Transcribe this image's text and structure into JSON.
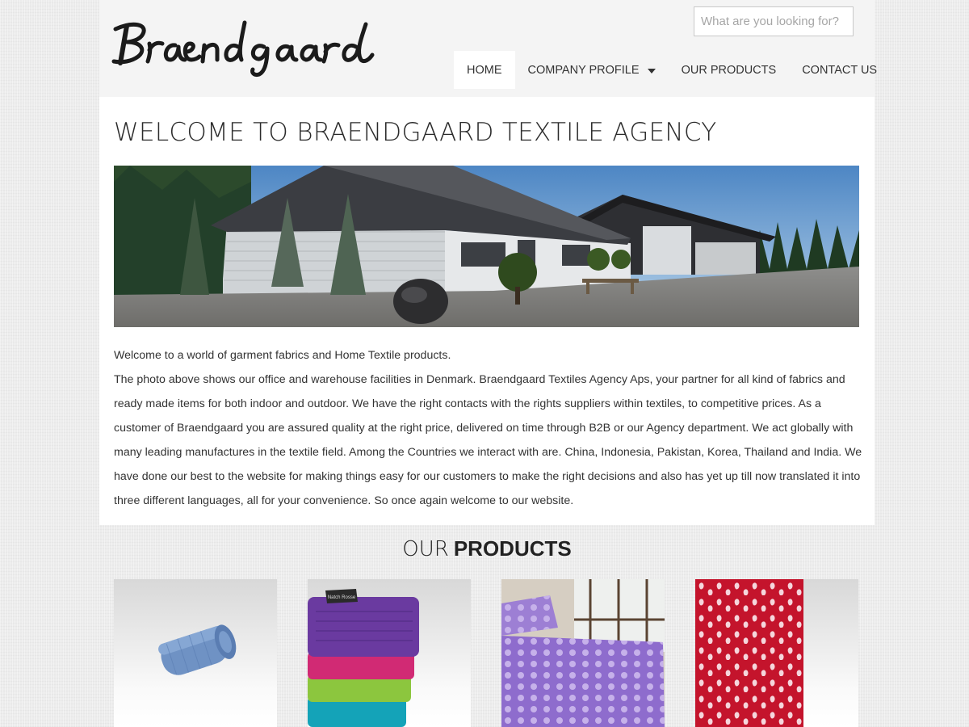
{
  "header": {
    "logo_text": "Braendgaard",
    "search_placeholder": "What are you looking for?",
    "nav": [
      {
        "label": "HOME",
        "active": true
      },
      {
        "label": "COMPANY PROFILE",
        "has_dropdown": true
      },
      {
        "label": "OUR PRODUCTS"
      },
      {
        "label": "CONTACT US"
      }
    ]
  },
  "main": {
    "title": "WELCOME TO BRAENDGAARD TEXTILE AGENCY",
    "intro_line": "Welcome to a world of garment fabrics and Home Textile products.",
    "paragraph": "The photo above shows our office and warehouse facilities in Denmark. Braendgaard Textiles Agency Aps, your partner for all kind of fabrics and ready made items for both indoor and outdoor. We have the right contacts with the rights suppliers within textiles, to competitive prices. As a customer of Braendgaard you are assured quality at the right price, delivered on time through B2B or our Agency department. We act globally with many leading manufactures in the textile field. Among the Countries we interact with are. China, Indonesia, Pakistan, Korea, Thailand and India. We have done our best to the website for making things easy for our customers to make the right decisions and also has yet up till now translated it into three different languages, all for your convenience. So once again welcome to our website."
  },
  "products": {
    "heading_light": "OUR",
    "heading_bold": "PRODUCTS",
    "items": [
      {
        "name": "rolled-blue-blanket"
      },
      {
        "name": "stacked-towels",
        "tag_text": "Natch Rosse"
      },
      {
        "name": "polka-dot-bedding"
      },
      {
        "name": "red-paisley-fabric"
      }
    ]
  },
  "colors": {
    "page_bg": "#ececec",
    "header_bg": "#f4f4f4",
    "content_bg": "#ffffff",
    "text": "#333333"
  }
}
